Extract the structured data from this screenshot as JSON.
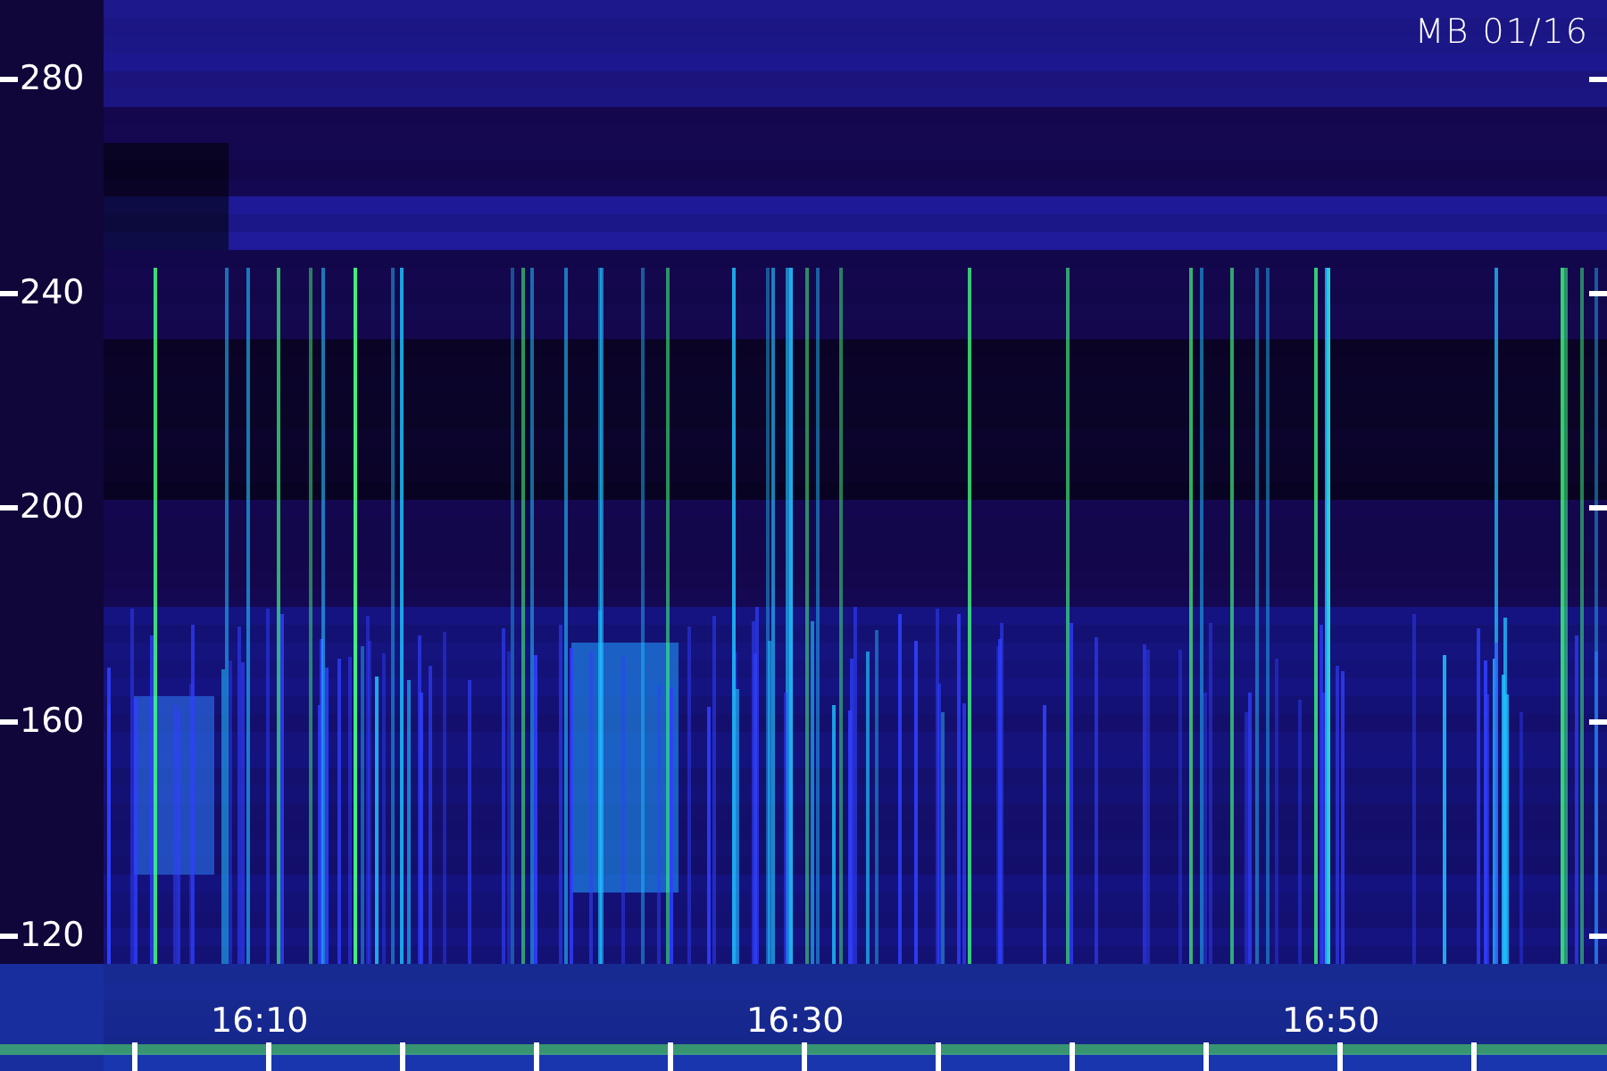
{
  "title": "MB 01/16",
  "y_axis": {
    "labels": [
      "280",
      "240",
      "200",
      "160",
      "120"
    ]
  },
  "x_axis": {
    "labels": [
      "16:10",
      "16:30",
      "16:50"
    ]
  }
}
